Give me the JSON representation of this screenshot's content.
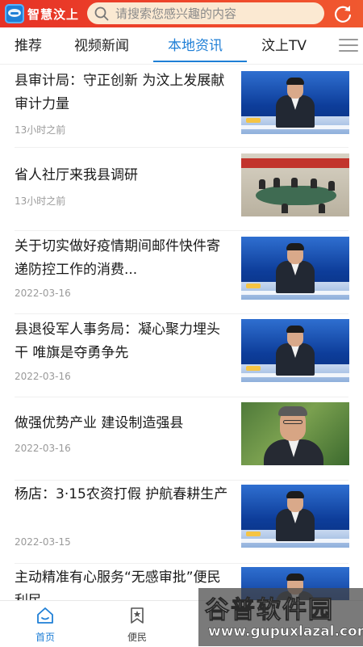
{
  "header": {
    "app_name": "智慧汶上",
    "search_placeholder": "请搜索您感兴趣的内容",
    "icons": {
      "logo": "app-logo",
      "search": "search-icon",
      "refresh": "refresh-icon"
    },
    "colors": {
      "bar": "#e63226",
      "search_bg": "#fbe9d2"
    }
  },
  "tabs": [
    {
      "label": "推荐"
    },
    {
      "label": "视频新闻"
    },
    {
      "label": "本地资讯",
      "active": true
    },
    {
      "label": "汶上TV"
    }
  ],
  "accent_color": "#1f7fd6",
  "news": [
    {
      "title": "县审计局：守正创新  为汶上发展献审计力量",
      "time": "13小时之前",
      "thumb": "anchor"
    },
    {
      "title": "省人社厅来我县调研",
      "time": "13小时之前",
      "thumb": "meeting"
    },
    {
      "title": "关于切实做好疫情期间邮件快件寄递防控工作的消费...",
      "time": "2022-03-16",
      "thumb": "anchor"
    },
    {
      "title": "县退役军人事务局：凝心聚力埋头干  唯旗是夺勇争先",
      "time": "2022-03-16",
      "thumb": "anchor"
    },
    {
      "title": "做强优势产业 建设制造强县",
      "time": "2022-03-16",
      "thumb": "portrait"
    },
    {
      "title": "杨店：3·15农资打假 护航春耕生产",
      "time": "2022-03-15",
      "thumb": "anchor"
    },
    {
      "title": "主动精准有心服务“无感审批”便民利民",
      "time": "",
      "thumb": "anchor"
    }
  ],
  "bottom_nav": [
    {
      "label": "首页",
      "icon": "home-icon",
      "active": true
    },
    {
      "label": "便民",
      "icon": "bookmark-star-icon"
    }
  ],
  "watermark": {
    "text": "谷普软件园",
    "url": "www.gupuxlazal.com"
  }
}
